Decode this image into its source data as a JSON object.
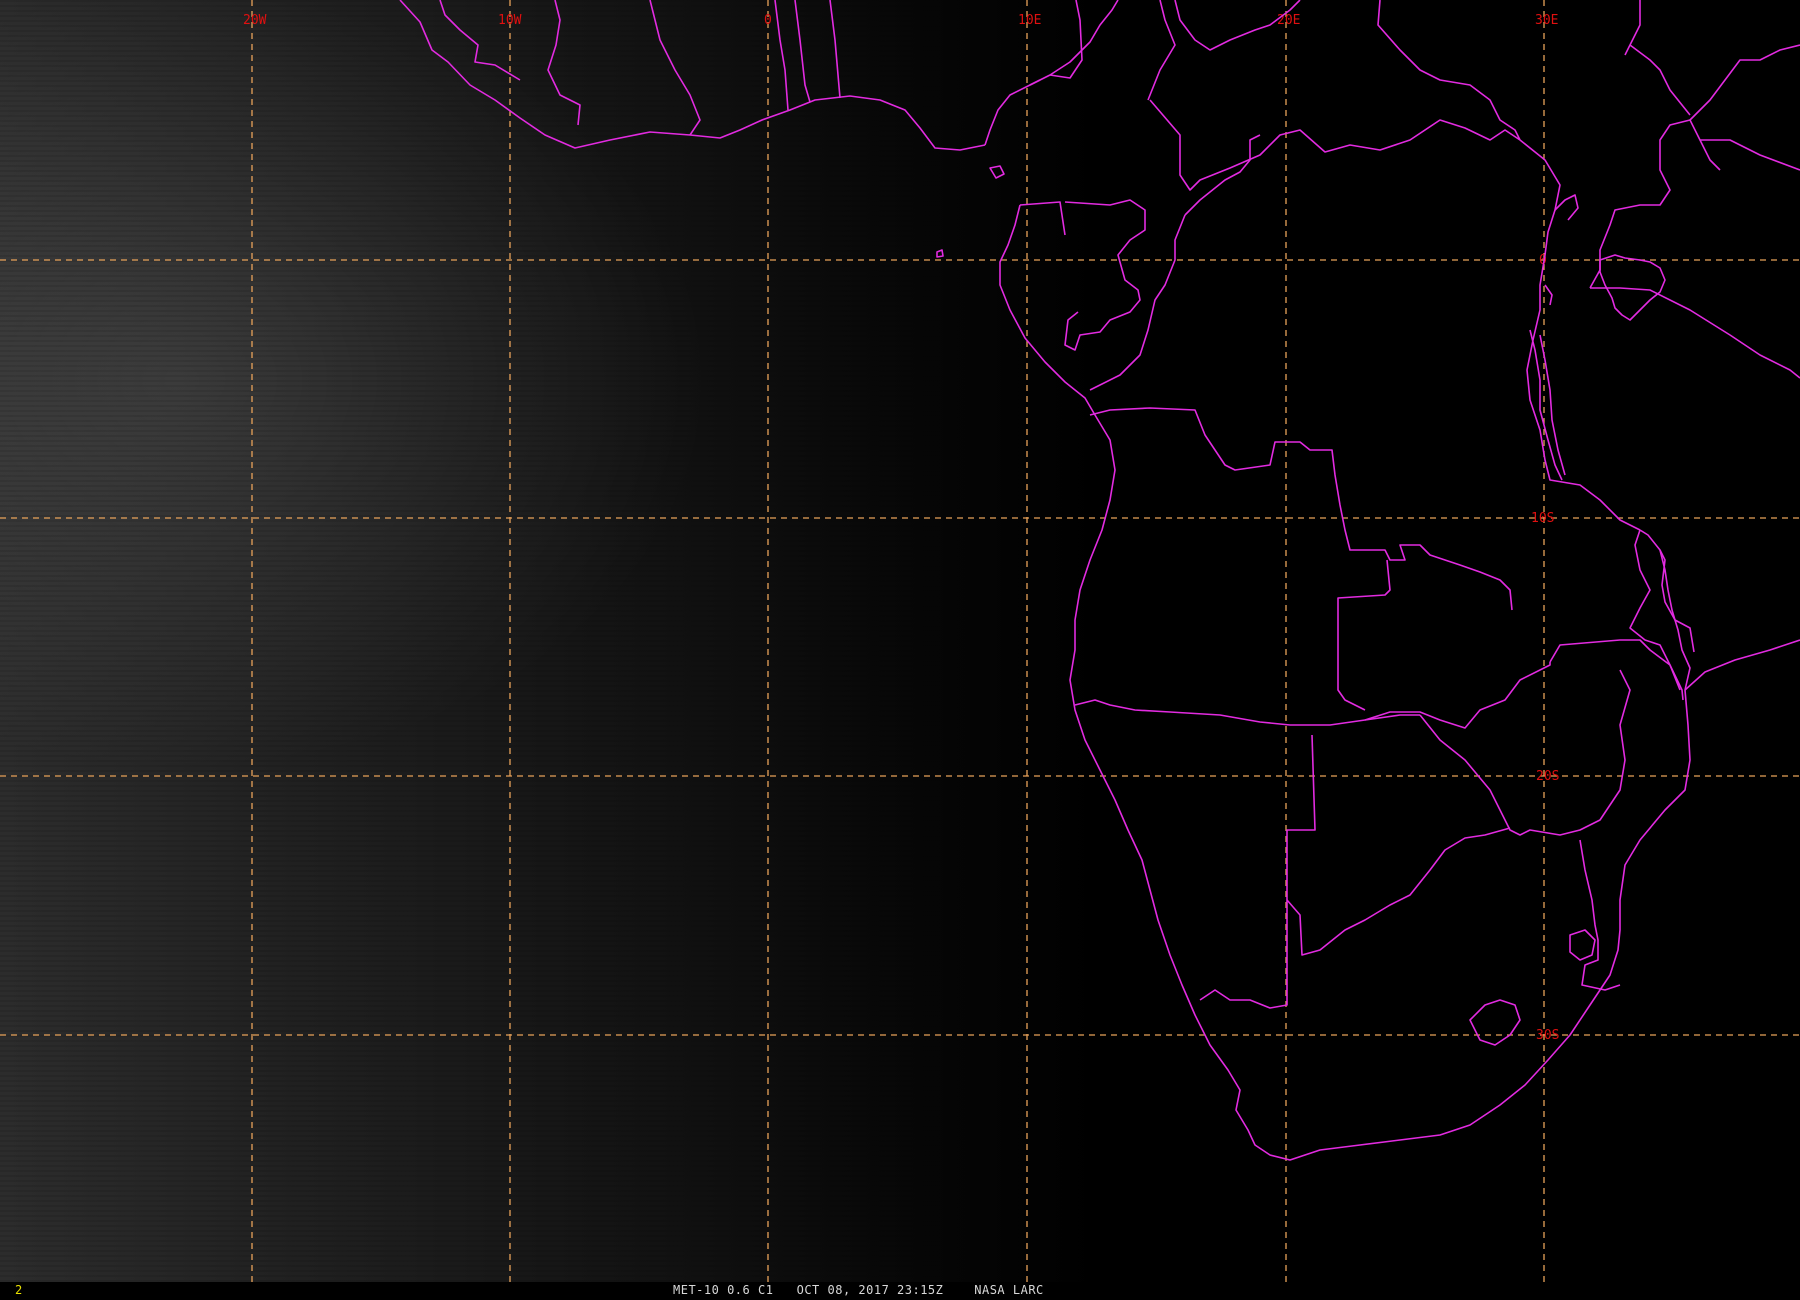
{
  "grid": {
    "longitude_labels": [
      "20W",
      "10W",
      "0",
      "10E",
      "20E",
      "30E"
    ],
    "latitude_labels": [
      "0",
      "10S",
      "20S",
      "30S"
    ]
  },
  "status_bar": {
    "frame_number": "2",
    "caption": "MET-10 0.6 C1   OCT 08, 2017 23:15Z    NASA LARC"
  },
  "colors": {
    "coastline": "#e22be0",
    "grid_lines": "#e8a25a",
    "grid_labels": "#e01010",
    "frame_number": "#e8e000",
    "caption": "#d8d8d8"
  }
}
